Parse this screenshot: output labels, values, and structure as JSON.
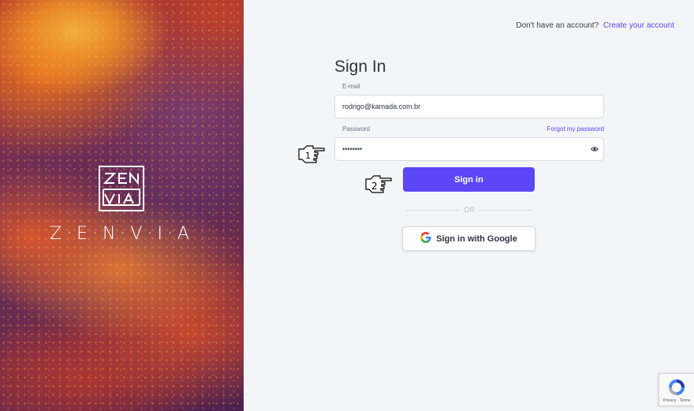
{
  "brand": {
    "name": "Z·E·N·V·I·A",
    "logo_text": "ZEN VIA"
  },
  "header": {
    "question": "Don't have an account?",
    "create_link": "Create your account"
  },
  "form": {
    "title": "Sign In",
    "email_label": "E-mail",
    "email_value": "rodrigo@kamada.com.br",
    "password_label": "Password",
    "forgot_link": "Forgot my password",
    "password_value": "••••••••",
    "signin_label": "Sign in",
    "or_text": "OR",
    "google_label": "Sign in with Google"
  },
  "annotations": {
    "step1": "1",
    "step2": "2"
  },
  "recaptcha": {
    "footer": "Privacy - Terms"
  },
  "colors": {
    "accent": "#5b47f5",
    "background": "#f4f5f8"
  },
  "icons": [
    "eye-icon",
    "google-icon",
    "pointing-hand-icon",
    "recaptcha-icon"
  ]
}
